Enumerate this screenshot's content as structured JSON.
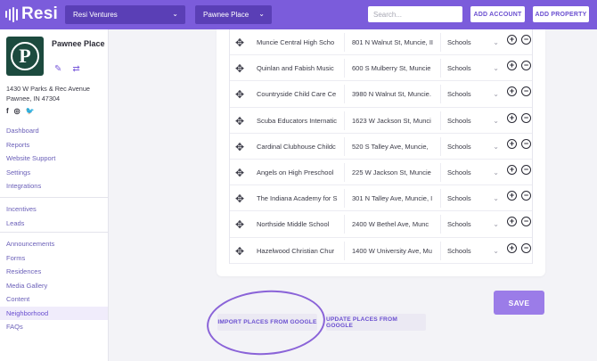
{
  "header": {
    "logo": "Resi",
    "account_select": "Resi Ventures",
    "property_select": "Pawnee Place",
    "search_placeholder": "Search...",
    "add_account": "ADD ACCOUNT",
    "add_property": "ADD PROPERTY"
  },
  "property": {
    "logo_letter": "P",
    "name": "Pawnee Place",
    "address_line1": "1430 W Parks & Rec Avenue",
    "address_line2": "Pawnee, IN 47304",
    "social": [
      "facebook",
      "instagram",
      "twitter"
    ]
  },
  "nav": {
    "group1": [
      "Dashboard",
      "Reports",
      "Website Support",
      "Settings",
      "Integrations"
    ],
    "group2": [
      "Incentives",
      "Leads"
    ],
    "group3": [
      "Announcements",
      "Forms",
      "Residences",
      "Media Gallery",
      "Content",
      "Neighborhood",
      "FAQs"
    ],
    "active": "Neighborhood"
  },
  "places": [
    {
      "name": "Muncie Central High Scho",
      "address": "801 N Walnut St, Muncie, II",
      "type": "Schools"
    },
    {
      "name": "Quinlan and Fabish Music",
      "address": "600 S Mulberry St, Muncie",
      "type": "Schools"
    },
    {
      "name": "Countryside Child Care Ce",
      "address": "3980 N Walnut St, Muncie.",
      "type": "Schools"
    },
    {
      "name": "Scuba Educators Internatic",
      "address": "1623 W Jackson St, Munci",
      "type": "Schools"
    },
    {
      "name": "Cardinal Clubhouse Childc",
      "address": "520 S Talley Ave, Muncie,",
      "type": "Schools"
    },
    {
      "name": "Angels on High Preschool",
      "address": "225 W Jackson St, Muncie",
      "type": "Schools"
    },
    {
      "name": "The Indiana Academy for S",
      "address": "301 N Talley Ave, Muncie, I",
      "type": "Schools"
    },
    {
      "name": "Northside Middle School",
      "address": "2400 W Bethel Ave, Munc",
      "type": "Schools"
    },
    {
      "name": "Hazelwood Christian Chur",
      "address": "1400 W University Ave, Mu",
      "type": "Schools"
    }
  ],
  "actions": {
    "save": "SAVE",
    "import": "IMPORT PLACES FROM GOOGLE",
    "update": "UPDATE PLACES FROM GOOGLE"
  }
}
